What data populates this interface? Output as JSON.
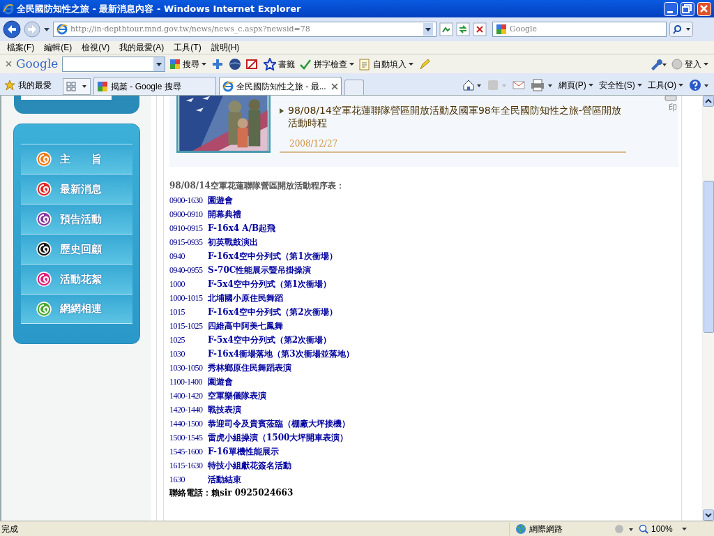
{
  "window": {
    "title": "全民國防知性之旅 - 最新消息內容 - Windows Internet Explorer"
  },
  "address": {
    "url": "http://in-depthtour.mnd.gov.tw/news/news_c.aspx?newsid=78"
  },
  "search": {
    "placeholder": "Google"
  },
  "menu": [
    "檔案(F)",
    "編輯(E)",
    "檢視(V)",
    "我的最愛(A)",
    "工具(T)",
    "說明(H)"
  ],
  "google_toolbar": {
    "logo": "Google",
    "search": "搜尋",
    "bookmarks": "書籤",
    "spellcheck": "拼字檢查",
    "autofill": "自動填入",
    "login": "登入"
  },
  "favorites": "我的最愛",
  "tabs": [
    {
      "label": "揭棻 - Google 搜尋",
      "selected": false
    },
    {
      "label": "全民國防知性之旅 - 最...",
      "selected": true
    }
  ],
  "command_bar": [
    "網頁(P)",
    "安全性(S)",
    "工具(O)"
  ],
  "nav_items": [
    {
      "label": "主　　旨",
      "color": "#f07a1a"
    },
    {
      "label": "最新消息",
      "color": "#e02828"
    },
    {
      "label": "預告活動",
      "color": "#8a3aa0"
    },
    {
      "label": "歷史回顧",
      "color": "#1a1a1a"
    },
    {
      "label": "活動花絮",
      "color": "#e0207a"
    },
    {
      "label": "網網相連",
      "color": "#4aa832"
    }
  ],
  "article": {
    "title": "98/08/14空軍花蓮聯隊營區開放活動及國軍98年全民國防知性之旅-營區開放活動時程",
    "date": "2008/12/27",
    "print_label": "印",
    "heading": "98/08/14空軍花蓮聯隊營區開放活動程序表：",
    "schedule": [
      {
        "time": "0900-1630",
        "event": "園遊會"
      },
      {
        "time": "0900-0910",
        "event": "開幕典禮"
      },
      {
        "time": "0910-0915",
        "event": "F-16x4 A/B起飛"
      },
      {
        "time": "0915-0935",
        "event": "初英戰鼓演出"
      },
      {
        "time": "0940",
        "event": "F-16x4空中分列式（第1次衝場）"
      },
      {
        "time": "0940-0955",
        "event": "S-70C性能展示暨吊掛操演"
      },
      {
        "time": "1000",
        "event": "F-5x4空中分列式（第1次衝場）"
      },
      {
        "time": "1000-1015",
        "event": "北埔國小原住民舞蹈"
      },
      {
        "time": "1015",
        "event": "F-16x4空中分列式（第2次衝場）"
      },
      {
        "time": "1015-1025",
        "event": "四維高中阿美七鳳舞"
      },
      {
        "time": "1025",
        "event": "F-5x4空中分列式（第2次衝場）"
      },
      {
        "time": "1030",
        "event": "F-16x4衝場落地（第3次衝場並落地）"
      },
      {
        "time": "1030-1050",
        "event": "秀林鄉原住民舞蹈表演"
      },
      {
        "time": "1100-1400",
        "event": "園遊會"
      },
      {
        "time": "1400-1420",
        "event": "空軍樂儀隊表演"
      },
      {
        "time": "1420-1440",
        "event": "戰技表演"
      },
      {
        "time": "1440-1500",
        "event": "恭迎司令及貴賓蒞臨（棚廠大坪接機）"
      },
      {
        "time": "1500-1545",
        "event": "雷虎小組操演（1500大坪開車表演）"
      },
      {
        "time": "1545-1600",
        "event": "F-16單機性能展示"
      },
      {
        "time": "1615-1630",
        "event": "特技小組獻花簽名活動"
      },
      {
        "time": "1630",
        "event": "活動結束"
      }
    ],
    "contact": "聯絡電話：賴sir 0925024663"
  },
  "status_bar": {
    "text": "完成",
    "zone": "網際網路",
    "zoom": "100%"
  }
}
